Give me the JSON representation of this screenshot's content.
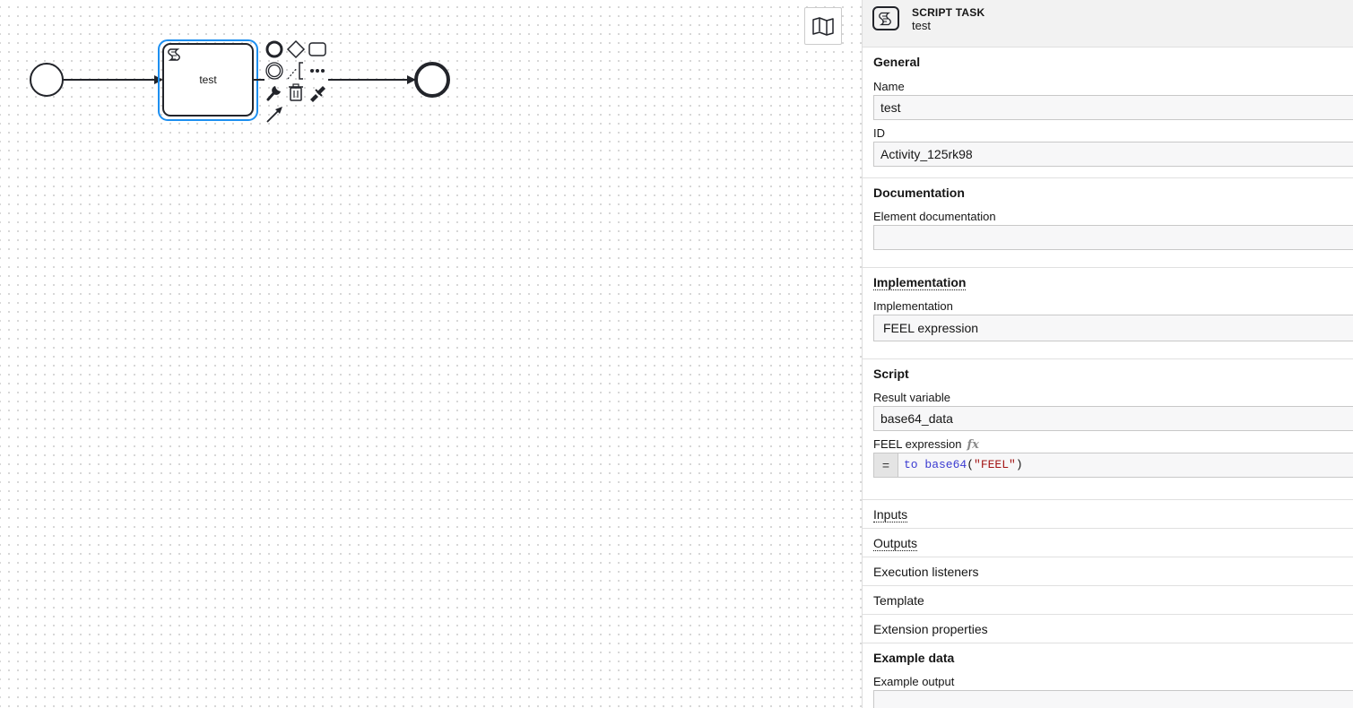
{
  "diagram": {
    "task_name": "test"
  },
  "panel": {
    "header": {
      "element_type": "SCRIPT TASK",
      "element_name": "test"
    },
    "general": {
      "title": "General",
      "name_label": "Name",
      "name_value": "test",
      "id_label": "ID",
      "id_value": "Activity_125rk98"
    },
    "documentation": {
      "title": "Documentation",
      "element_doc_label": "Element documentation",
      "element_doc_value": ""
    },
    "implementation": {
      "title": "Implementation",
      "field_label": "Implementation",
      "selected": "FEEL expression"
    },
    "script": {
      "title": "Script",
      "result_variable_label": "Result variable",
      "result_variable_value": "base64_data",
      "feel_label": "FEEL expression",
      "feel_fx": "fx",
      "feel_eq": "=",
      "feel_code_fn": "to base64",
      "feel_code_open": "(",
      "feel_code_arg": "\"FEEL\"",
      "feel_code_close": ")"
    },
    "collapsed_groups": {
      "inputs": "Inputs",
      "outputs": "Outputs",
      "execution_listeners": "Execution listeners",
      "template": "Template",
      "extension_properties": "Extension properties"
    },
    "example_data": {
      "title": "Example data",
      "example_output_label": "Example output"
    }
  },
  "colors": {
    "selection": "#1d8ff0",
    "stroke": "#22242a",
    "panel_header_bg": "#f2f2f2"
  },
  "icons": {
    "minimap": "map-icon",
    "script_task": "script-icon",
    "context_pad": [
      "end-event-icon",
      "gateway-icon",
      "task-icon",
      "intermediate-event-icon",
      "text-annotation-icon",
      "more-icon",
      "wrench-icon",
      "trash-icon",
      "color-picker-icon",
      "connect-icon"
    ]
  }
}
